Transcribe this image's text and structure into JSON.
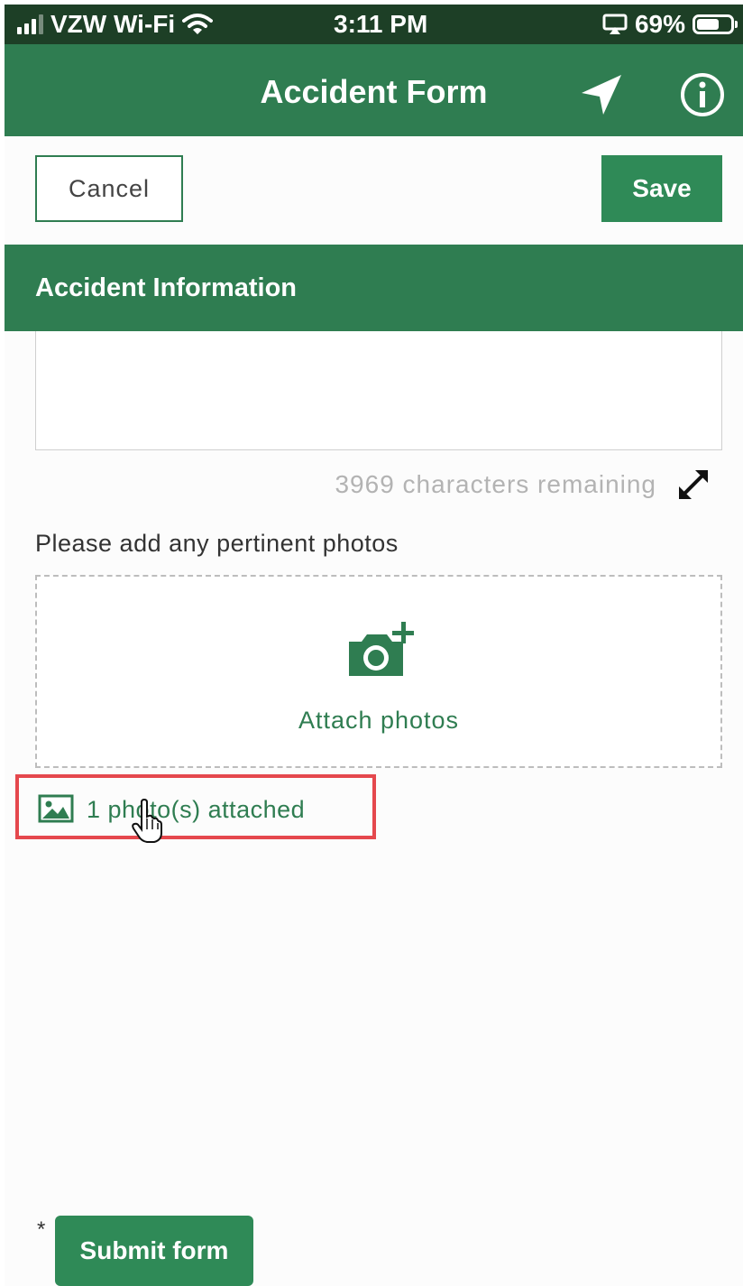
{
  "status_bar": {
    "carrier": "VZW Wi-Fi",
    "time": "3:11 PM",
    "battery": "69%",
    "battery_level": 0.69,
    "icons": [
      "signal-icon",
      "wifi-icon",
      "screen-mirroring-icon",
      "battery-icon"
    ]
  },
  "header": {
    "title": "Accident Form",
    "icons": [
      "location-arrow-icon",
      "info-icon"
    ]
  },
  "actions": {
    "cancel_label": "Cancel",
    "save_label": "Save"
  },
  "section": {
    "title": "Accident Information"
  },
  "description": {
    "value": "",
    "chars_remaining": "3969 characters remaining",
    "expand_icon": "expand-icon"
  },
  "photos": {
    "label": "Please add any pertinent photos",
    "attach_label": "Attach photos",
    "attached_text": "1 photo(s) attached",
    "icons": [
      "camera-plus-icon",
      "image-icon"
    ]
  },
  "submit": {
    "required_mark": "*",
    "label": "Submit form"
  },
  "colors": {
    "primary": "#2f7d51",
    "button": "#2f8a57",
    "status_bar": "#1d3f26",
    "highlight": "#e5484d"
  }
}
